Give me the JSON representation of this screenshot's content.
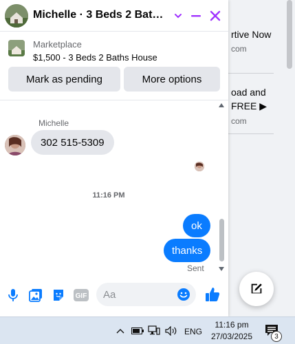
{
  "background": {
    "ad1": {
      "line1": "rtive Now",
      "line2": "com"
    },
    "ad2": {
      "line1": "oad and",
      "line1b": "FREE ▶",
      "line2": "com"
    }
  },
  "chat": {
    "title": "Michelle · 3 Beds 2 Baths ...",
    "header_icons": {
      "chevron": "chevron-down-icon",
      "minimize": "minimize-icon",
      "close": "close-icon"
    },
    "accent_color": "#a033ff",
    "listing": {
      "source": "Marketplace",
      "title": "$1,500 - 3 Beds 2 Baths House",
      "buttons": {
        "pending": "Mark as pending",
        "more": "More options"
      }
    },
    "messages": {
      "sender": "Michelle",
      "incoming": "302 515-5309",
      "timestamp": "11:16 PM",
      "outgoing": [
        "ok",
        "thanks"
      ],
      "status": "Sent"
    },
    "composer": {
      "placeholder": "Aa",
      "icons": [
        "microphone-icon",
        "gallery-icon",
        "sticker-icon",
        "gif-icon",
        "emoji-icon",
        "thumbs-up-icon"
      ],
      "gif_label": "GIF"
    },
    "message_color": "#0a7cff"
  },
  "taskbar": {
    "language": "ENG",
    "time": "11:16 pm",
    "date": "27/03/2025",
    "notification_count": "3"
  }
}
